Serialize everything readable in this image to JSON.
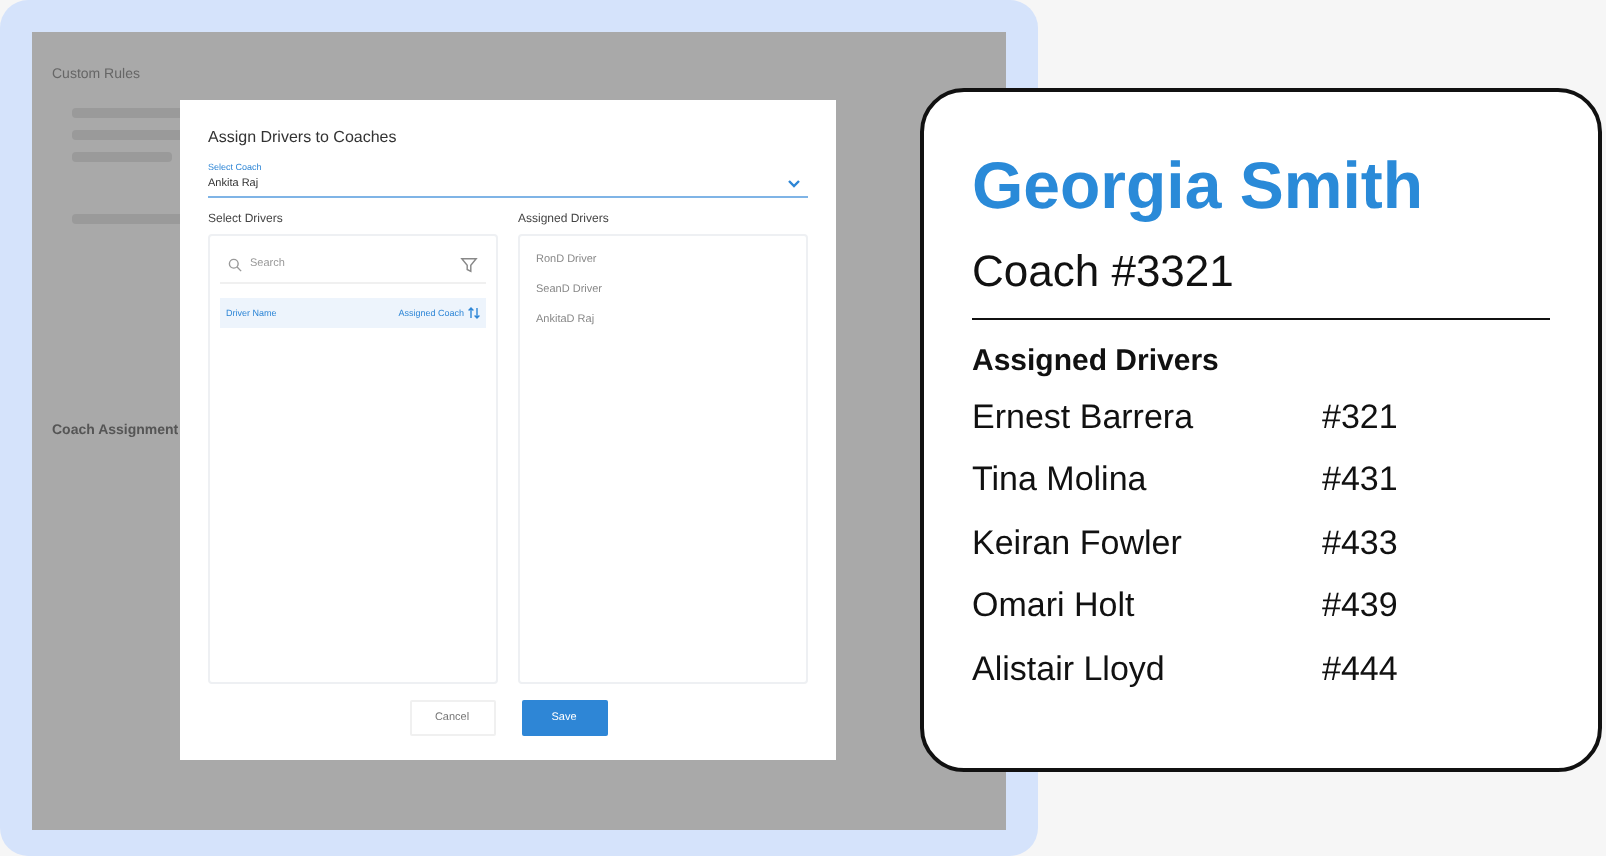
{
  "background_page": {
    "tab": "Custom Rules",
    "section_title": "Coach Assignment"
  },
  "modal": {
    "title": "Assign Drivers to Coaches",
    "coach_field": {
      "label": "Select Coach",
      "value": "Ankita Raj"
    },
    "select_drivers": {
      "heading": "Select Drivers",
      "search_placeholder": "Search",
      "columns": [
        "Driver Name",
        "Assigned Coach"
      ]
    },
    "assigned_drivers": {
      "heading": "Assigned Drivers",
      "items": [
        "RonD Driver",
        "SeanD Driver",
        "AnkitaD Raj"
      ]
    },
    "buttons": [
      {
        "label": "Cancel",
        "kind": "secondary"
      },
      {
        "label": "Save",
        "kind": "primary"
      }
    ]
  },
  "coach_card": {
    "name": "Georgia Smith",
    "coach": "Coach #3321",
    "heading": "Assigned Drivers",
    "drivers": [
      {
        "name": "Ernest Barrera",
        "number": "#321"
      },
      {
        "name": "Tina Molina",
        "number": "#431"
      },
      {
        "name": "Keiran Fowler",
        "number": "#433"
      },
      {
        "name": "Omari Holt",
        "number": "#439"
      },
      {
        "name": "Alistair Lloyd",
        "number": "#444"
      }
    ]
  }
}
